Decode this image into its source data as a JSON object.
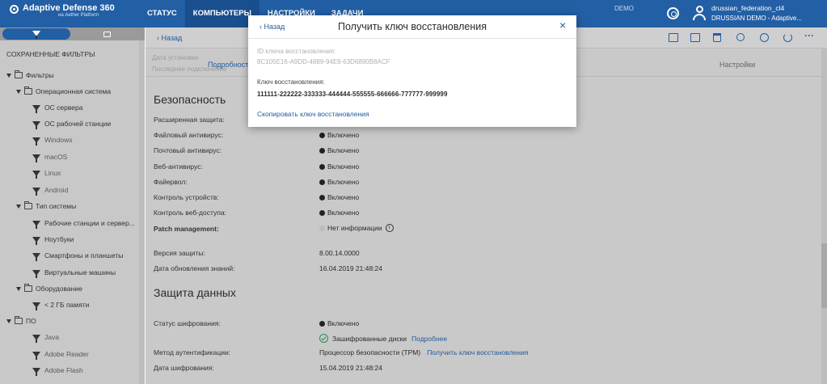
{
  "app": {
    "brand": "Adaptive Defense 360",
    "brand_sub": "на Aether Platform",
    "nav": [
      "СТАТУС",
      "КОМПЬЮТЕРЫ",
      "НАСТРОЙКИ",
      "ЗАДАЧИ"
    ],
    "active_nav": "КОМПЬЮТЕРЫ",
    "demo_label": "DEMO",
    "user_name": "drussian_federation_cl4",
    "user_org": "DRUSSIAN DEMO - Adaptive..."
  },
  "sidebar": {
    "saved_filters_title": "СОХРАНЕННЫЕ ФИЛЬТРЫ",
    "tree": [
      {
        "label": "Фильтры",
        "type": "folder",
        "level": 0
      },
      {
        "label": "Операционная система",
        "type": "folder",
        "level": 1
      },
      {
        "label": "ОС сервера",
        "type": "filter",
        "level": 2
      },
      {
        "label": "ОС рабочей станции",
        "type": "filter",
        "level": 2
      },
      {
        "label": "Windows",
        "type": "filter",
        "level": 2
      },
      {
        "label": "macOS",
        "type": "filter",
        "level": 2
      },
      {
        "label": "Linux",
        "type": "filter",
        "level": 2
      },
      {
        "label": "Android",
        "type": "filter",
        "level": 2
      },
      {
        "label": "Тип системы",
        "type": "folder",
        "level": 1
      },
      {
        "label": "Рабочие станции и сервер...",
        "type": "filter",
        "level": 2
      },
      {
        "label": "Ноутбуки",
        "type": "filter",
        "level": 2
      },
      {
        "label": "Смартфоны и планшеты",
        "type": "filter",
        "level": 2
      },
      {
        "label": "Виртуальные машины",
        "type": "filter",
        "level": 2
      },
      {
        "label": "Оборудование",
        "type": "folder",
        "level": 1
      },
      {
        "label": "< 2 ГБ памяти",
        "type": "filter",
        "level": 2
      },
      {
        "label": "ПО",
        "type": "folder",
        "level": 1
      },
      {
        "label": "Java",
        "type": "filter",
        "level": 2
      },
      {
        "label": "Adobe Reader",
        "type": "filter",
        "level": 2
      },
      {
        "label": "Adobe Flash",
        "type": "filter",
        "level": 2
      }
    ]
  },
  "toolbar": {
    "back_label": "Назад"
  },
  "subtabs": {
    "left_top": "Дата установки",
    "left_bottom": "Последнее подключение",
    "details": "Подробности",
    "settings": "Настройки"
  },
  "security": {
    "title": "Безопасность",
    "rows": [
      {
        "label": "Расширенная защита:",
        "value": "",
        "status": "none"
      },
      {
        "label": "Файловый антивирус:",
        "value": "Включено",
        "status": "on"
      },
      {
        "label": "Почтовый антивирус:",
        "value": "Включено",
        "status": "on"
      },
      {
        "label": "Веб-антивирус:",
        "value": "Включено",
        "status": "on"
      },
      {
        "label": "Файервол:",
        "value": "Включено",
        "status": "on"
      },
      {
        "label": "Контроль устройств:",
        "value": "Включено",
        "status": "on"
      },
      {
        "label": "Контроль веб-доступа:",
        "value": "Включено",
        "status": "on"
      },
      {
        "label": "Patch management:",
        "value": "Нет информации",
        "status": "unknown"
      }
    ],
    "version_label": "Версия защиты:",
    "version_value": "8.00.14.0000",
    "update_label": "Дата обновления знаний:",
    "update_value": "16.04.2019 21:48:24"
  },
  "data_protection": {
    "title": "Защита данных",
    "encryption_status_label": "Статус шифрования:",
    "encryption_status_value": "Включено",
    "encrypted_disks": "Зашифрованные диски",
    "more_link": "Подробнее",
    "auth_method_label": "Метод аутентификации:",
    "auth_method_value": "Процессор безопасности (TPM)",
    "get_key_link": "Получить ключ восстановления",
    "encryption_date_label": "Дата шифрования:",
    "encryption_date_value": "15.04.2019 21:48:24"
  },
  "modal": {
    "back": "Назад",
    "title": "Получить ключ восстановления",
    "close": "×",
    "id_label": "ID ключа восстановления:",
    "id_value": "8C105E16-A9DD-4889-94E9-63D6890B8ACF",
    "key_label": "Ключ восстановления:",
    "key_value": "111111-222222-333333-444444-555555-666666-777777-999999",
    "copy_link": "Скопировать ключ восстановления"
  },
  "colors": {
    "topbar": "#225fa5",
    "link": "#1f5b9c",
    "status_on": "#222222",
    "status_unknown": "#bbbbbb",
    "check": "#2e8b57"
  }
}
